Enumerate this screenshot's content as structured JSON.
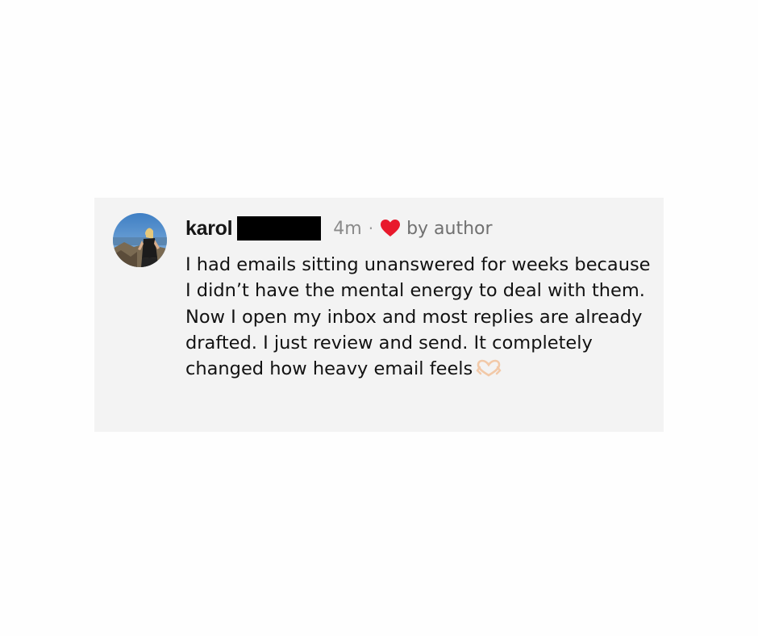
{
  "comment": {
    "username": "karol",
    "timestamp": "4m",
    "separator": "·",
    "liked_icon": "heart-icon",
    "liked_color": "#e8192c",
    "liked_label": "by author",
    "text": "I had emails sitting unanswered for weeks because I didn’t have the mental energy to deal with them. Now I open my inbox and most replies are already drafted. I just review and send. It completely changed how heavy email feels",
    "emoji_icon": "heart-hands-icon"
  },
  "colors": {
    "card_background": "#f3f3f3",
    "page_background": "#fefefe"
  }
}
